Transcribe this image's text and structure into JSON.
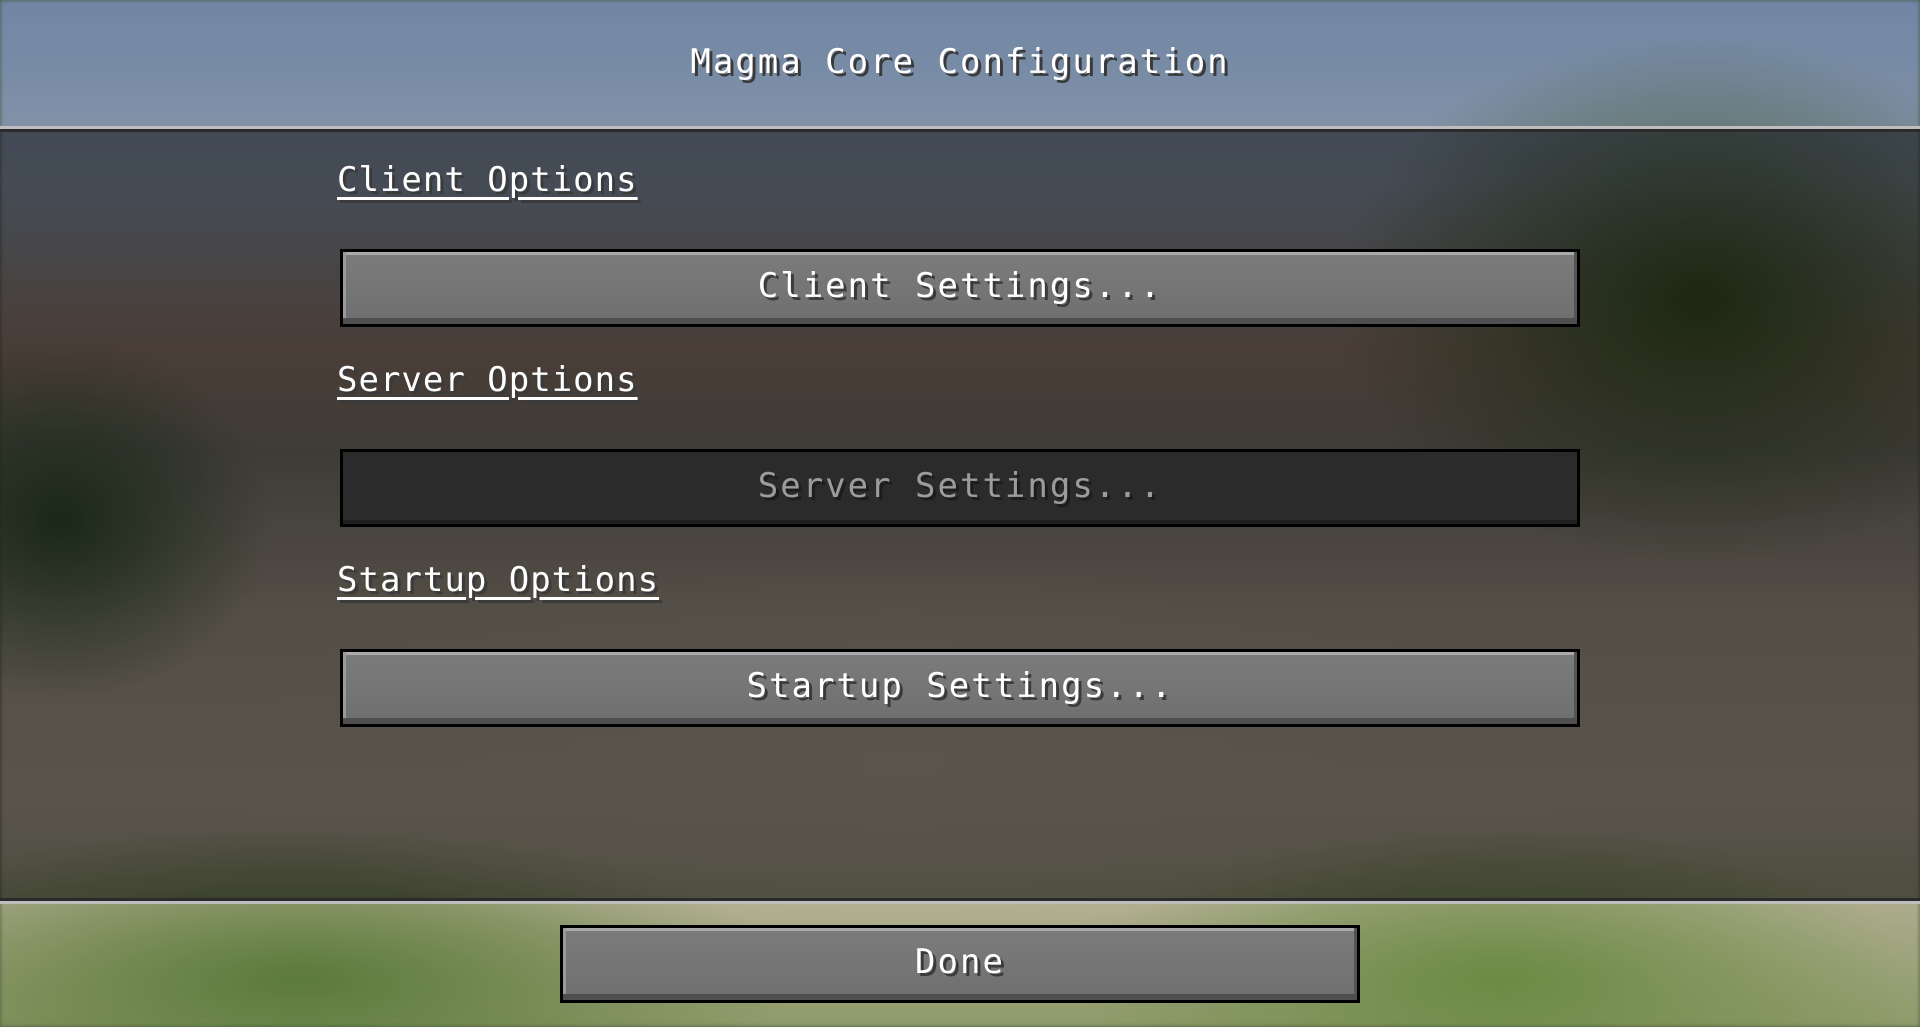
{
  "screen": {
    "title": "Magma Core Configuration"
  },
  "sections": [
    {
      "label": "Client Options",
      "button_label": "Client Settings...",
      "enabled": true
    },
    {
      "label": "Server Options",
      "button_label": "Server Settings...",
      "enabled": false
    },
    {
      "label": "Startup Options",
      "button_label": "Startup Settings...",
      "enabled": true
    }
  ],
  "footer": {
    "done_label": "Done"
  }
}
